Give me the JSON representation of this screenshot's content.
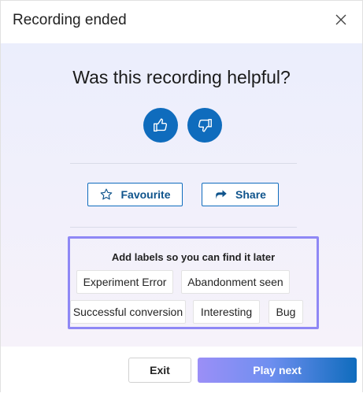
{
  "dialog": {
    "title": "Recording ended",
    "close_icon": "close-icon"
  },
  "feedback": {
    "question": "Was this recording helpful?",
    "thumbs_up_icon": "thumbs-up-icon",
    "thumbs_down_icon": "thumbs-down-icon"
  },
  "actions": {
    "favourite_label": "Favourite",
    "favourite_icon": "star-icon",
    "share_label": "Share",
    "share_icon": "share-icon"
  },
  "labels": {
    "heading": "Add labels so you can find it later",
    "chips": [
      "Experiment Error",
      "Abandonment seen",
      "Successful conversion",
      "Interesting",
      "Bug"
    ]
  },
  "footer": {
    "exit_label": "Exit",
    "play_next_label": "Play next"
  },
  "colors": {
    "accent": "#0f6cbd",
    "highlight_border": "#8f88f5"
  }
}
